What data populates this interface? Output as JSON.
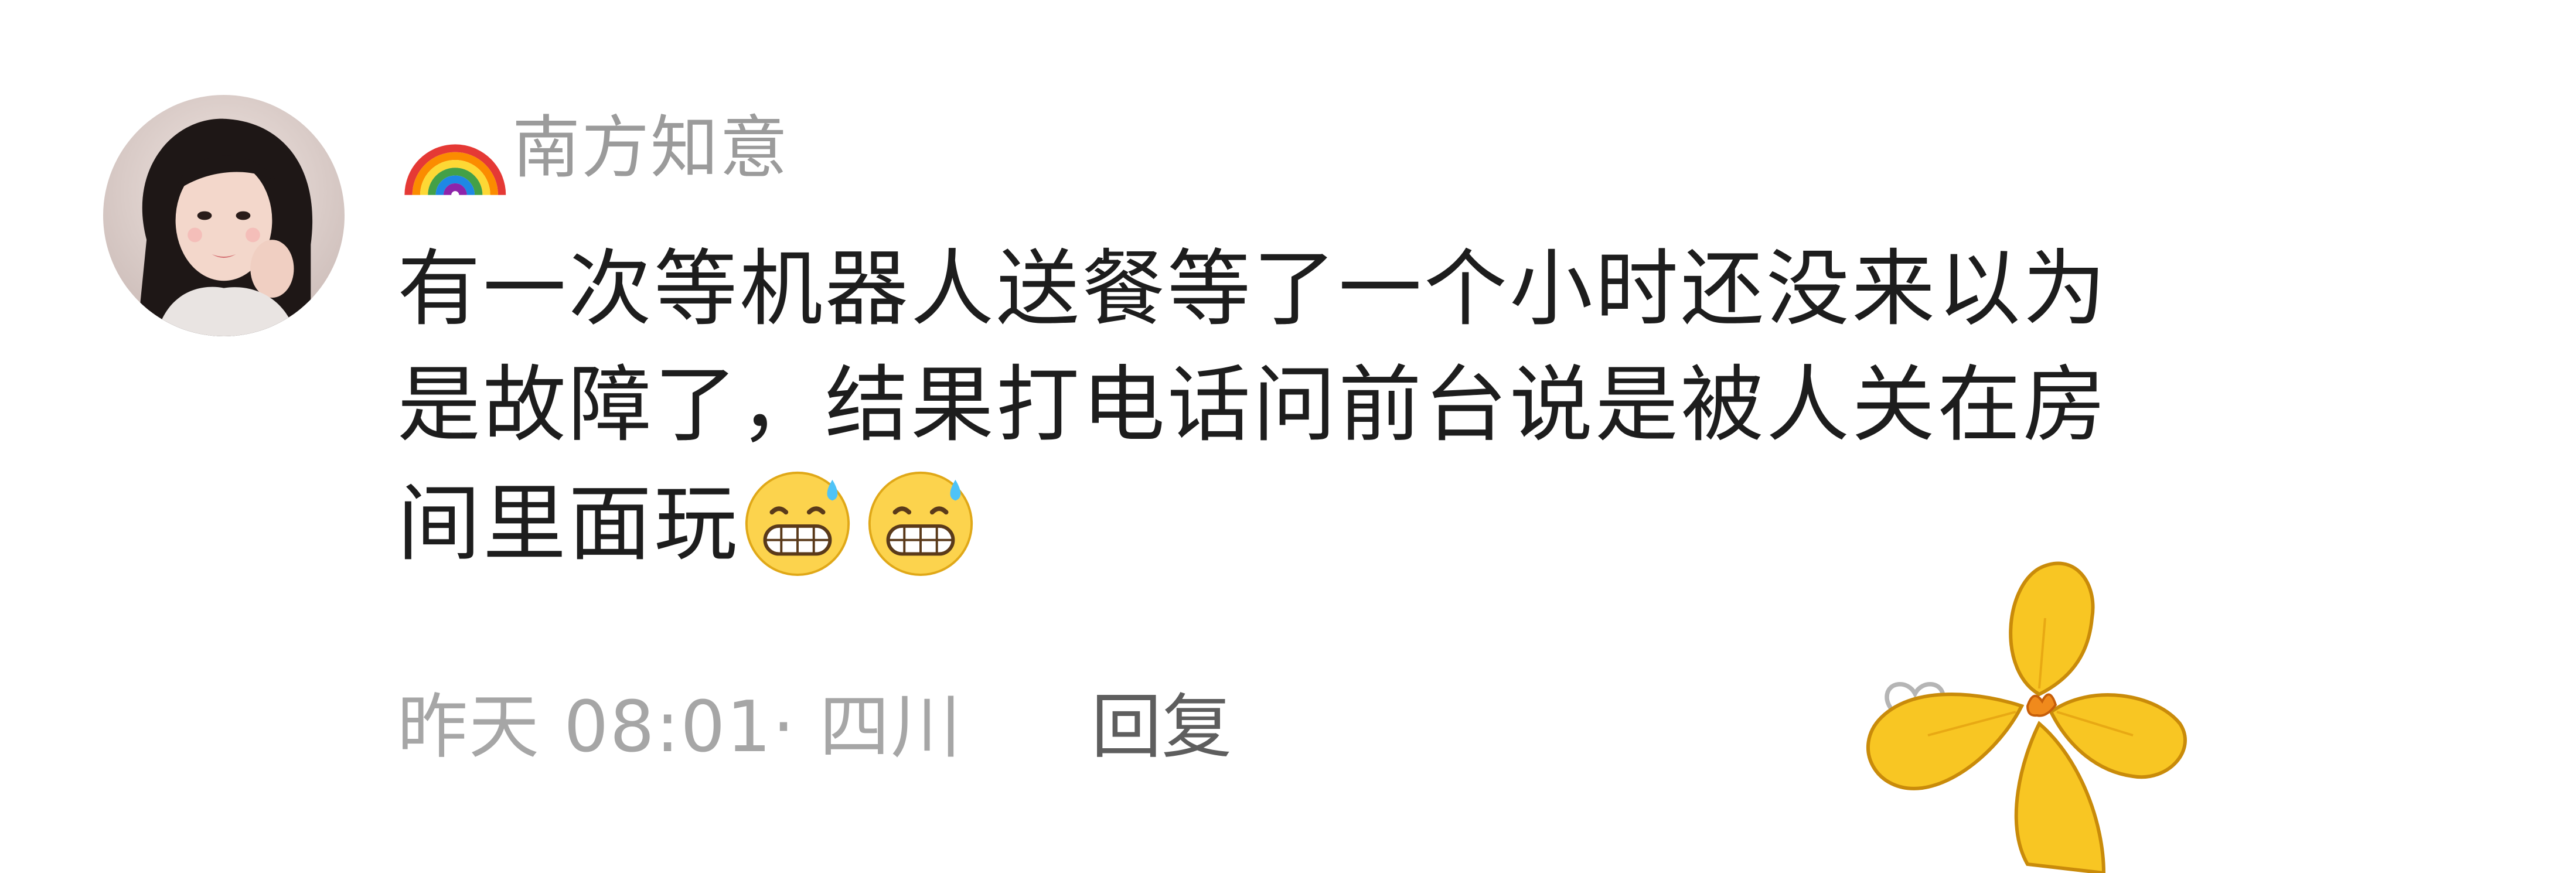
{
  "comment": {
    "avatar_icon": "user-avatar-photo",
    "name_icon": "rainbow-emoji",
    "username": "南方知意",
    "text_lines": [
      "有一次等机器人送餐等了一个小时还没来以为",
      "是故障了，结果打电话问前台说是被人关在房",
      "间里面玩"
    ],
    "emojis": [
      "grimacing-sweat-emoji",
      "grimacing-sweat-emoji"
    ],
    "time_location": "昨天 08:01· 四川",
    "reply_label": "回复",
    "like_icon": "heart-icon",
    "sticker": "yellow-flower-sticker"
  },
  "colors": {
    "username": "#9b9b9b",
    "text": "#1d1d1d",
    "meta": "#a6a6a6",
    "reply": "#5e5e5e",
    "flower": "#f6c51e"
  }
}
